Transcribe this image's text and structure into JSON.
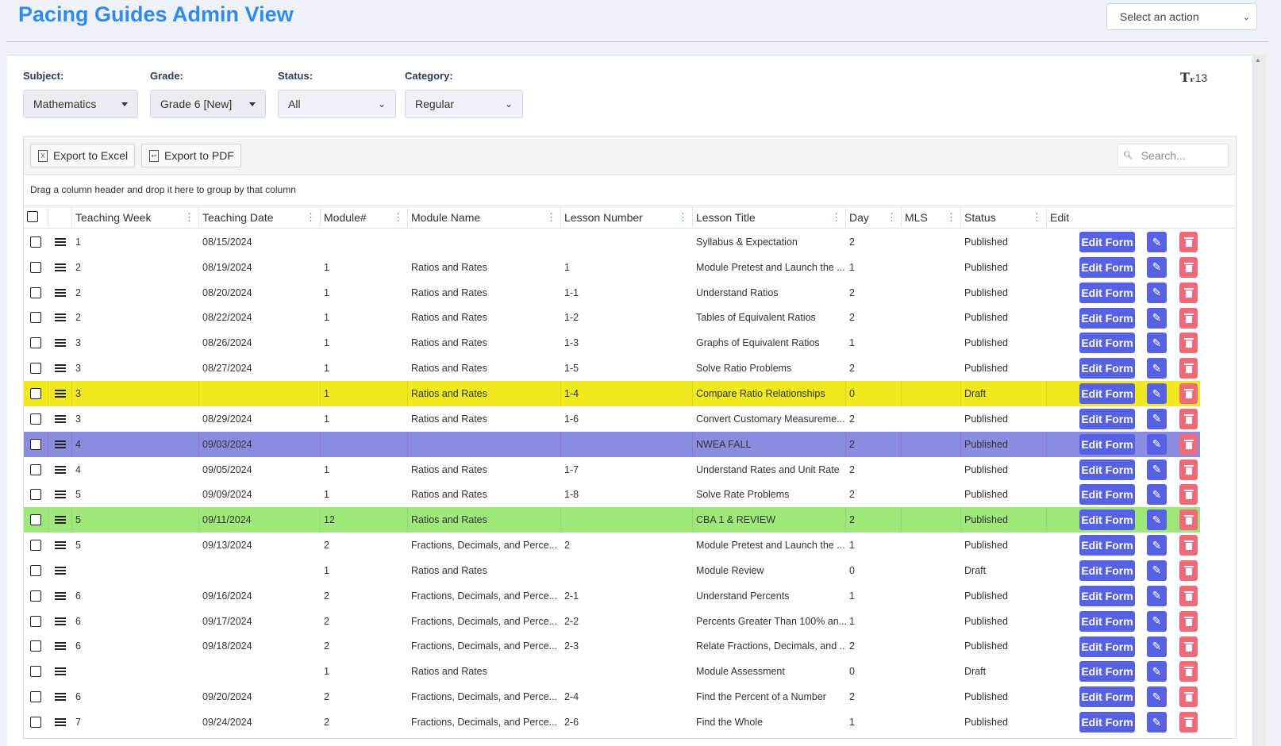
{
  "header": {
    "title": "Pacing Guides Admin View",
    "action_select": "Select an action"
  },
  "filters": {
    "subject": {
      "label": "Subject:",
      "value": "Mathematics"
    },
    "grade": {
      "label": "Grade:",
      "value": "Grade 6 [New]"
    },
    "status": {
      "label": "Status:",
      "value": "All"
    },
    "category": {
      "label": "Category:",
      "value": "Regular"
    },
    "font_size": "13"
  },
  "toolbar": {
    "export_excel": "Export to Excel",
    "export_pdf": "Export to PDF",
    "search_placeholder": "Search...",
    "group_hint": "Drag a column header and drop it here to group by that column"
  },
  "columns": [
    "Teaching Week",
    "Teaching Date",
    "Module#",
    "Module Name",
    "Lesson Number",
    "Lesson Title",
    "Day",
    "MLS",
    "Status",
    "Edit"
  ],
  "row_colors": {
    "yellow": "#f0e91f",
    "purple": "#8b8be0",
    "green": "#9de879"
  },
  "actions": {
    "edit_form": "Edit Form"
  },
  "rows": [
    {
      "week": "1",
      "date": "08/15/2024",
      "module": "",
      "module_name": "",
      "lesson_number": "",
      "lesson_title": "Syllabus & Expectation",
      "day": "2",
      "mls": "",
      "status": "Published",
      "highlight": ""
    },
    {
      "week": "2",
      "date": "08/19/2024",
      "module": "1",
      "module_name": "Ratios and Rates",
      "lesson_number": "1",
      "lesson_title": "Module Pretest and Launch the ...",
      "day": "1",
      "mls": "",
      "status": "Published",
      "highlight": ""
    },
    {
      "week": "2",
      "date": "08/20/2024",
      "module": "1",
      "module_name": "Ratios and Rates",
      "lesson_number": "1-1",
      "lesson_title": "Understand Ratios",
      "day": "2",
      "mls": "",
      "status": "Published",
      "highlight": ""
    },
    {
      "week": "2",
      "date": "08/22/2024",
      "module": "1",
      "module_name": "Ratios and Rates",
      "lesson_number": "1-2",
      "lesson_title": "Tables of Equivalent Ratios",
      "day": "2",
      "mls": "",
      "status": "Published",
      "highlight": ""
    },
    {
      "week": "3",
      "date": "08/26/2024",
      "module": "1",
      "module_name": "Ratios and Rates",
      "lesson_number": "1-3",
      "lesson_title": "Graphs of Equivalent Ratios",
      "day": "1",
      "mls": "",
      "status": "Published",
      "highlight": ""
    },
    {
      "week": "3",
      "date": "08/27/2024",
      "module": "1",
      "module_name": "Ratios and Rates",
      "lesson_number": "1-5",
      "lesson_title": "Solve Ratio Problems",
      "day": "2",
      "mls": "",
      "status": "Published",
      "highlight": ""
    },
    {
      "week": "3",
      "date": "",
      "module": "1",
      "module_name": "Ratios and Rates",
      "lesson_number": "1-4",
      "lesson_title": "Compare Ratio Relationships",
      "day": "0",
      "mls": "",
      "status": "Draft",
      "highlight": "yellow"
    },
    {
      "week": "3",
      "date": "08/29/2024",
      "module": "1",
      "module_name": "Ratios and Rates",
      "lesson_number": "1-6",
      "lesson_title": "Convert Customary Measureme...",
      "day": "2",
      "mls": "",
      "status": "Published",
      "highlight": ""
    },
    {
      "week": "4",
      "date": "09/03/2024",
      "module": "",
      "module_name": "",
      "lesson_number": "",
      "lesson_title": "NWEA FALL",
      "day": "2",
      "mls": "",
      "status": "Published",
      "highlight": "purple"
    },
    {
      "week": "4",
      "date": "09/05/2024",
      "module": "1",
      "module_name": "Ratios and Rates",
      "lesson_number": "1-7",
      "lesson_title": "Understand Rates and Unit Rate",
      "day": "2",
      "mls": "",
      "status": "Published",
      "highlight": ""
    },
    {
      "week": "5",
      "date": "09/09/2024",
      "module": "1",
      "module_name": "Ratios and Rates",
      "lesson_number": "1-8",
      "lesson_title": "Solve Rate Problems",
      "day": "2",
      "mls": "",
      "status": "Published",
      "highlight": ""
    },
    {
      "week": "5",
      "date": "09/11/2024",
      "module": "12",
      "module_name": "Ratios and Rates",
      "lesson_number": "",
      "lesson_title": "CBA 1 & REVIEW",
      "day": "2",
      "mls": "",
      "status": "Published",
      "highlight": "green"
    },
    {
      "week": "5",
      "date": "09/13/2024",
      "module": "2",
      "module_name": "Fractions, Decimals, and Perce...",
      "lesson_number": "2",
      "lesson_title": "Module Pretest and Launch the ...",
      "day": "1",
      "mls": "",
      "status": "Published",
      "highlight": ""
    },
    {
      "week": "",
      "date": "",
      "module": "1",
      "module_name": "Ratios and Rates",
      "lesson_number": "",
      "lesson_title": "Module Review",
      "day": "0",
      "mls": "",
      "status": "Draft",
      "highlight": ""
    },
    {
      "week": "6",
      "date": "09/16/2024",
      "module": "2",
      "module_name": "Fractions, Decimals, and Perce...",
      "lesson_number": "2-1",
      "lesson_title": "Understand Percents",
      "day": "1",
      "mls": "",
      "status": "Published",
      "highlight": ""
    },
    {
      "week": "6",
      "date": "09/17/2024",
      "module": "2",
      "module_name": "Fractions, Decimals, and Perce...",
      "lesson_number": "2-2",
      "lesson_title": "Percents Greater Than 100% an...",
      "day": "1",
      "mls": "",
      "status": "Published",
      "highlight": ""
    },
    {
      "week": "6",
      "date": "09/18/2024",
      "module": "2",
      "module_name": "Fractions, Decimals, and Perce...",
      "lesson_number": "2-3",
      "lesson_title": "Relate Fractions, Decimals, and ...",
      "day": "2",
      "mls": "",
      "status": "Published",
      "highlight": ""
    },
    {
      "week": "",
      "date": "",
      "module": "1",
      "module_name": "Ratios and Rates",
      "lesson_number": "",
      "lesson_title": "Module Assessment",
      "day": "0",
      "mls": "",
      "status": "Draft",
      "highlight": ""
    },
    {
      "week": "6",
      "date": "09/20/2024",
      "module": "2",
      "module_name": "Fractions, Decimals, and Perce...",
      "lesson_number": "2-4",
      "lesson_title": "Find the Percent of a Number",
      "day": "2",
      "mls": "",
      "status": "Published",
      "highlight": ""
    },
    {
      "week": "7",
      "date": "09/24/2024",
      "module": "2",
      "module_name": "Fractions, Decimals, and Perce...",
      "lesson_number": "2-6",
      "lesson_title": "Find the Whole",
      "day": "1",
      "mls": "",
      "status": "Published",
      "highlight": ""
    }
  ]
}
